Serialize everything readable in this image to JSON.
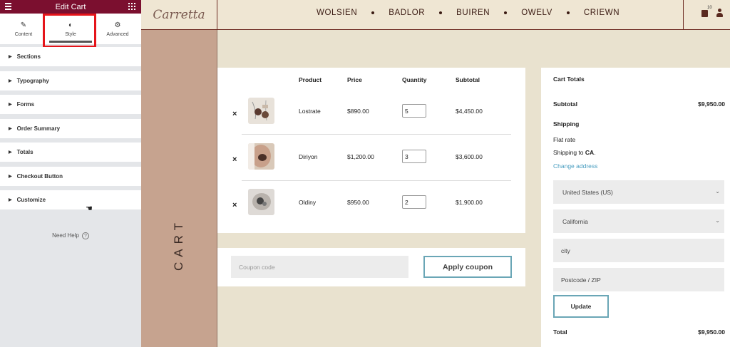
{
  "editor": {
    "title": "Edit Cart",
    "tabs": [
      {
        "label": "Content",
        "icon": "pencil-icon"
      },
      {
        "label": "Style",
        "icon": "contrast-icon"
      },
      {
        "label": "Advanced",
        "icon": "gear-icon"
      }
    ],
    "sections": [
      "Sections",
      "Typography",
      "Forms",
      "Order Summary",
      "Totals",
      "Checkout Button",
      "Customize"
    ],
    "need_help": "Need Help",
    "help_glyph": "?"
  },
  "site": {
    "logo": "Carretta",
    "nav": [
      "WOLSIEN",
      "BADLOR",
      "BUIREN",
      "OWELV",
      "CRIEWN"
    ],
    "cart_count": "10",
    "page_label": "CART"
  },
  "cart": {
    "headers": {
      "product": "Product",
      "price": "Price",
      "quantity": "Quantity",
      "subtotal": "Subtotal"
    },
    "remove_glyph": "×",
    "items": [
      {
        "product": "Lostrate",
        "price": "$890.00",
        "quantity": "5",
        "subtotal": "$4,450.00"
      },
      {
        "product": "Diriyon",
        "price": "$1,200.00",
        "quantity": "3",
        "subtotal": "$3,600.00"
      },
      {
        "product": "Oldiny",
        "price": "$950.00",
        "quantity": "2",
        "subtotal": "$1,900.00"
      }
    ],
    "coupon_placeholder": "Coupon code",
    "apply_label": "Apply coupon"
  },
  "totals": {
    "title": "Cart Totals",
    "subtotal_label": "Subtotal",
    "subtotal_value": "$9,950.00",
    "shipping_label": "Shipping",
    "flat_rate": "Flat rate",
    "shipping_to_prefix": "Shipping to ",
    "shipping_to_region": "CA",
    "shipping_to_suffix": ".",
    "change_address": "Change address",
    "country": "United States (US)",
    "state": "California",
    "city_placeholder": "city",
    "postcode_placeholder": "Postcode / ZIP",
    "update_label": "Update",
    "total_label": "Total",
    "total_value": "$9,950.00"
  },
  "colors": {
    "accent": "#7b0f2f",
    "highlight": "#e5141a",
    "button_border": "#6aa6b6",
    "link": "#4a9ec0"
  }
}
